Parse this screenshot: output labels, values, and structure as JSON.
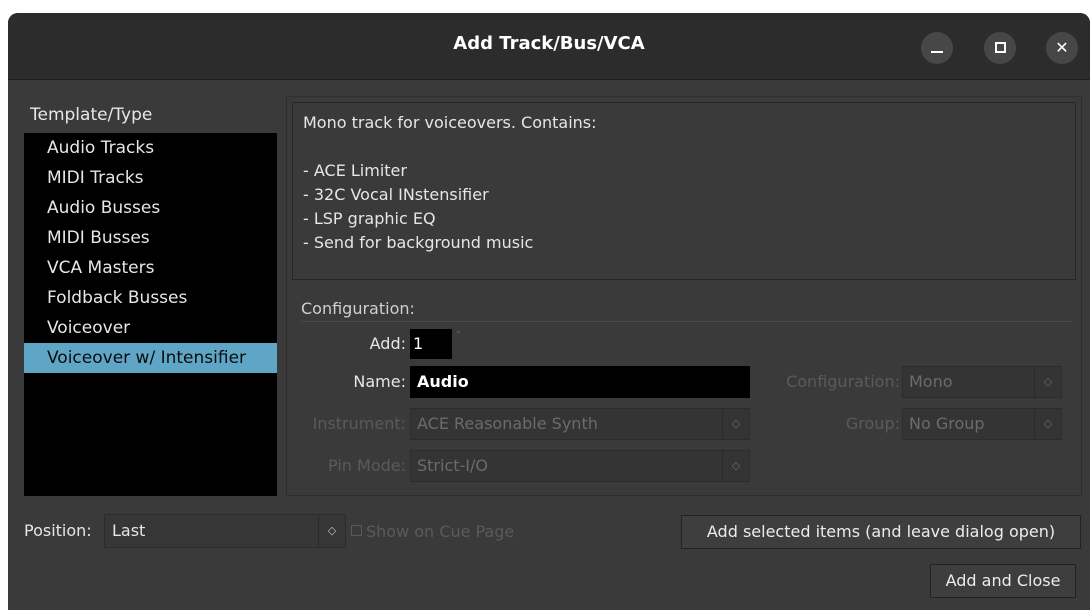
{
  "window": {
    "title": "Add Track/Bus/VCA",
    "controls": {
      "minimize": "–",
      "close": "✕"
    }
  },
  "template_list": {
    "label": "Template/Type",
    "items": [
      {
        "label": "Audio Tracks",
        "selected": false
      },
      {
        "label": "MIDI Tracks",
        "selected": false
      },
      {
        "label": "Audio Busses",
        "selected": false
      },
      {
        "label": "MIDI Busses",
        "selected": false
      },
      {
        "label": "VCA Masters",
        "selected": false
      },
      {
        "label": "Foldback Busses",
        "selected": false
      },
      {
        "label": "Voiceover",
        "selected": false
      },
      {
        "label": "Voiceover w/ Intensifier",
        "selected": true
      }
    ]
  },
  "description": {
    "lines": [
      "Mono track for voiceovers. Contains:",
      "",
      "- ACE Limiter",
      "- 32C Vocal INstensifier",
      "- LSP graphic EQ",
      "- Send for background music"
    ]
  },
  "configuration": {
    "section_label": "Configuration:",
    "add_label": "Add:",
    "add_value": "1",
    "name_label": "Name:",
    "name_value": "Audio",
    "config_label": "Configuration:",
    "config_value": "Mono",
    "instrument_label": "Instrument:",
    "instrument_value": "ACE Reasonable Synth",
    "group_label": "Group:",
    "group_value": "No Group",
    "pin_mode_label": "Pin Mode:",
    "pin_mode_value": "Strict-I/O"
  },
  "footer": {
    "position_label": "Position:",
    "position_value": "Last",
    "show_on_cue_label": "Show on Cue Page",
    "add_selected_label": "Add selected items (and leave dialog open)",
    "add_close_label": "Add and Close"
  },
  "colors": {
    "selection": "#5fa6c6",
    "window_bg": "#3a3a3a",
    "titlebar_bg": "#2c2c2c"
  }
}
